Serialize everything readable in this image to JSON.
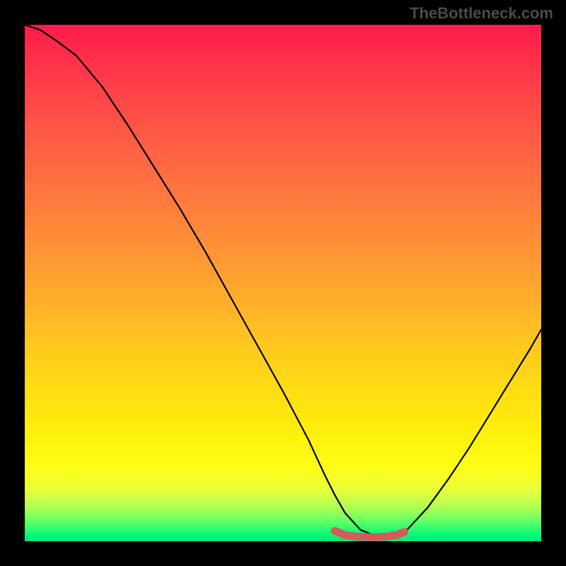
{
  "watermark": "TheBottleneck.com",
  "chart_data": {
    "type": "line",
    "title": "",
    "xlabel": "",
    "ylabel": "",
    "xlim": [
      0,
      100
    ],
    "ylim": [
      0,
      100
    ],
    "description": "Bottleneck curve: steep descent from top-left, minimum flat region around x=62-72, rising toward right edge. Background gradient maps color (red=high, green=low) to bottleneck magnitude.",
    "series": [
      {
        "name": "bottleneck-curve",
        "x": [
          0,
          3,
          6,
          10,
          15,
          20,
          25,
          30,
          35,
          40,
          45,
          50,
          55,
          58,
          60,
          62,
          65,
          68,
          70,
          72,
          74,
          78,
          82,
          86,
          90,
          94,
          98,
          100
        ],
        "values": [
          100,
          99,
          97,
          94,
          88,
          80.5,
          72.5,
          64.5,
          56,
          47,
          38,
          29,
          19.5,
          13,
          9,
          5.5,
          2.2,
          1.0,
          0.8,
          1.0,
          2.2,
          6.5,
          12,
          18,
          24.5,
          31,
          37.5,
          41
        ]
      }
    ],
    "minimum_marker": {
      "name": "flat-minimum-segment",
      "color": "#d65a5a",
      "x": [
        60,
        62,
        64,
        66,
        68,
        70,
        72,
        73.5
      ],
      "values": [
        2.0,
        1.2,
        0.9,
        0.8,
        0.8,
        0.9,
        1.2,
        1.8
      ]
    },
    "gradient_stops": [
      {
        "pos": 0,
        "color": "#ff1a4a"
      },
      {
        "pos": 0.14,
        "color": "#ff4548"
      },
      {
        "pos": 0.34,
        "color": "#ff7a3e"
      },
      {
        "pos": 0.54,
        "color": "#ffb02a"
      },
      {
        "pos": 0.72,
        "color": "#ffe012"
      },
      {
        "pos": 0.86,
        "color": "#fdff18"
      },
      {
        "pos": 0.93,
        "color": "#b8ff50"
      },
      {
        "pos": 0.99,
        "color": "#00f878"
      },
      {
        "pos": 1.0,
        "color": "#00e878"
      }
    ]
  }
}
